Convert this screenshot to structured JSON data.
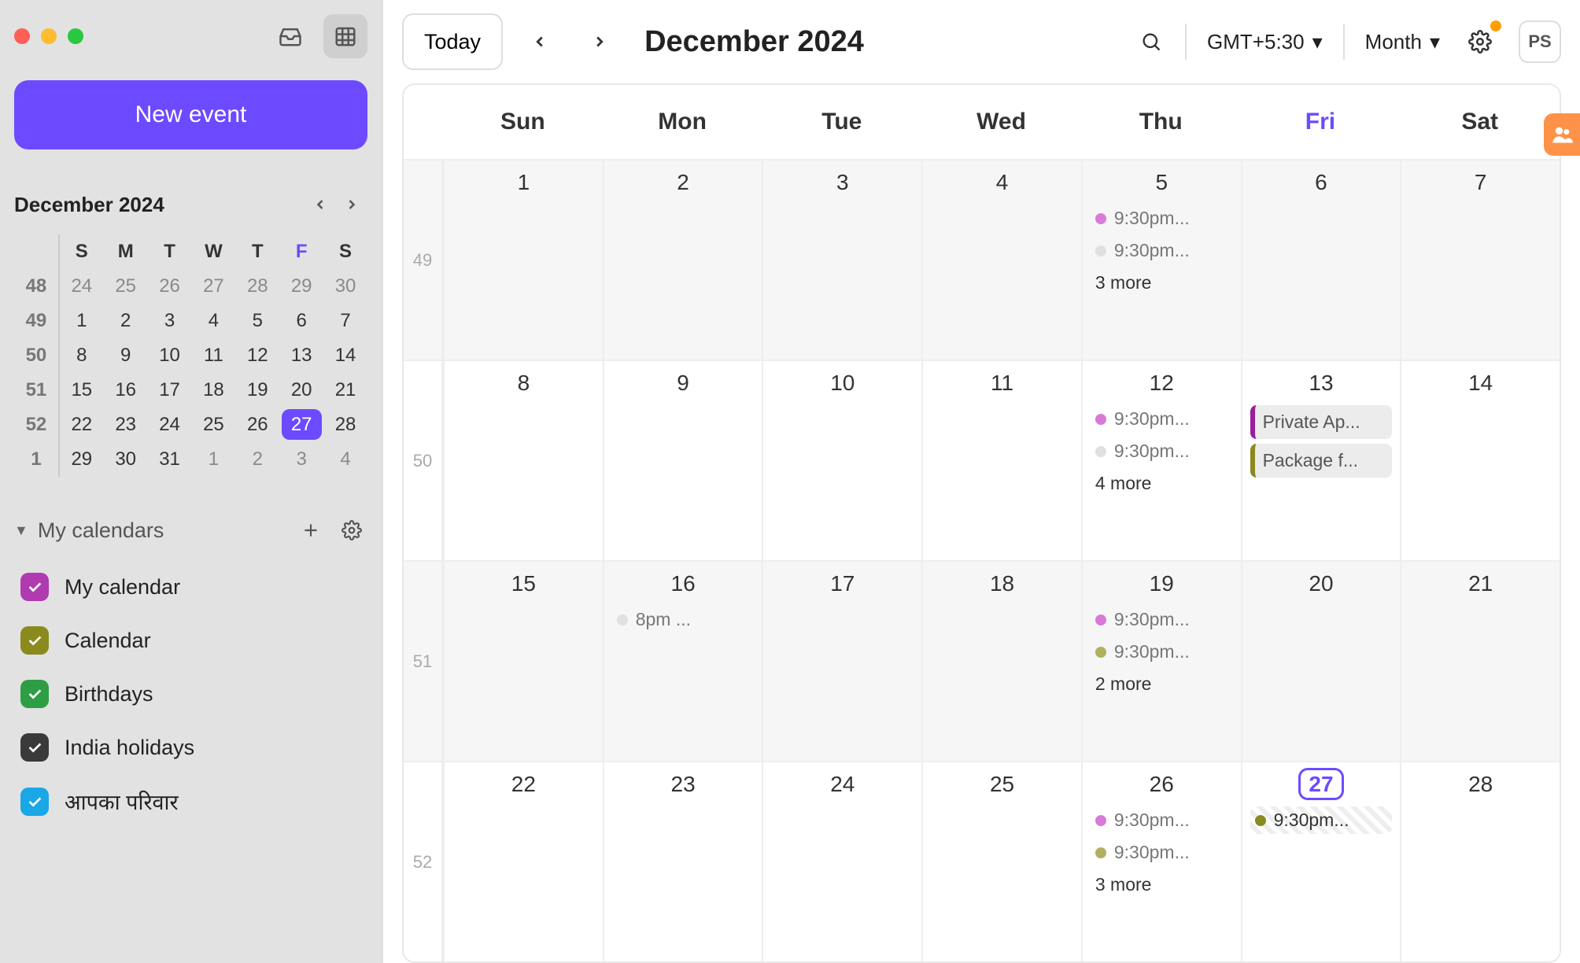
{
  "sidebar": {
    "new_event_label": "New event",
    "mini_cal_label": "December 2024",
    "weekday_headers": [
      "S",
      "M",
      "T",
      "W",
      "T",
      "F",
      "S"
    ],
    "mini_weeks": [
      {
        "wk": "48",
        "days": [
          "24",
          "25",
          "26",
          "27",
          "28",
          "29",
          "30"
        ],
        "other": true
      },
      {
        "wk": "49",
        "days": [
          "1",
          "2",
          "3",
          "4",
          "5",
          "6",
          "7"
        ]
      },
      {
        "wk": "50",
        "days": [
          "8",
          "9",
          "10",
          "11",
          "12",
          "13",
          "14"
        ]
      },
      {
        "wk": "51",
        "days": [
          "15",
          "16",
          "17",
          "18",
          "19",
          "20",
          "21"
        ]
      },
      {
        "wk": "52",
        "days": [
          "22",
          "23",
          "24",
          "25",
          "26",
          "27",
          "28"
        ],
        "today_idx": 5
      },
      {
        "wk": "1",
        "days": [
          "29",
          "30",
          "31",
          "1",
          "2",
          "3",
          "4"
        ],
        "other_from": 3
      }
    ],
    "my_calendars_label": "My calendars",
    "calendars": [
      {
        "name": "My calendar",
        "color": "#b03ab0"
      },
      {
        "name": "Calendar",
        "color": "#8a8a1f"
      },
      {
        "name": "Birthdays",
        "color": "#2e9e44"
      },
      {
        "name": "India holidays",
        "color": "#3a3a3a"
      },
      {
        "name": "आपका परिवार",
        "color": "#1aa7e6"
      }
    ]
  },
  "topbar": {
    "today_label": "Today",
    "current_label": "December 2024",
    "timezone_label": "GMT+5:30",
    "view_label": "Month",
    "avatar_initials": "PS"
  },
  "day_headers": [
    "Sun",
    "Mon",
    "Tue",
    "Wed",
    "Thu",
    "Fri",
    "Sat"
  ],
  "weeks": [
    {
      "wk": "49",
      "shade": true,
      "days": [
        {
          "n": "1"
        },
        {
          "n": "2"
        },
        {
          "n": "3"
        },
        {
          "n": "4"
        },
        {
          "n": "5",
          "events": [
            {
              "dot": "#d87ad8",
              "text": "9:30pm..."
            },
            {
              "dot": "#e0e0e0",
              "text": "9:30pm..."
            }
          ],
          "more": "3 more"
        },
        {
          "n": "6"
        },
        {
          "n": "7"
        }
      ]
    },
    {
      "wk": "50",
      "days": [
        {
          "n": "8"
        },
        {
          "n": "9"
        },
        {
          "n": "10"
        },
        {
          "n": "11"
        },
        {
          "n": "12",
          "events": [
            {
              "dot": "#d87ad8",
              "text": "9:30pm..."
            },
            {
              "dot": "#e0e0e0",
              "text": "9:30pm..."
            }
          ],
          "more": "4 more"
        },
        {
          "n": "13",
          "events": [
            {
              "block": true,
              "border": "#9a1f9a",
              "text": "Private Ap..."
            },
            {
              "block": true,
              "border": "#8a8a1f",
              "text": "Package f..."
            }
          ]
        },
        {
          "n": "14"
        }
      ]
    },
    {
      "wk": "51",
      "shade": true,
      "days": [
        {
          "n": "15"
        },
        {
          "n": "16",
          "events": [
            {
              "dot": "#e0e0e0",
              "text": "8pm ..."
            }
          ]
        },
        {
          "n": "17"
        },
        {
          "n": "18"
        },
        {
          "n": "19",
          "events": [
            {
              "dot": "#d87ad8",
              "text": "9:30pm..."
            },
            {
              "dot": "#b0b060",
              "text": "9:30pm..."
            }
          ],
          "more": "2 more"
        },
        {
          "n": "20"
        },
        {
          "n": "21"
        }
      ]
    },
    {
      "wk": "52",
      "days": [
        {
          "n": "22"
        },
        {
          "n": "23"
        },
        {
          "n": "24"
        },
        {
          "n": "25"
        },
        {
          "n": "26",
          "events": [
            {
              "dot": "#d87ad8",
              "text": "9:30pm..."
            },
            {
              "dot": "#b0b060",
              "text": "9:30pm..."
            }
          ],
          "more": "3 more"
        },
        {
          "n": "27",
          "today": true,
          "events": [
            {
              "hatched": true,
              "dot": "#8a8a1f",
              "text": "9:30pm..."
            }
          ]
        },
        {
          "n": "28"
        }
      ]
    }
  ]
}
